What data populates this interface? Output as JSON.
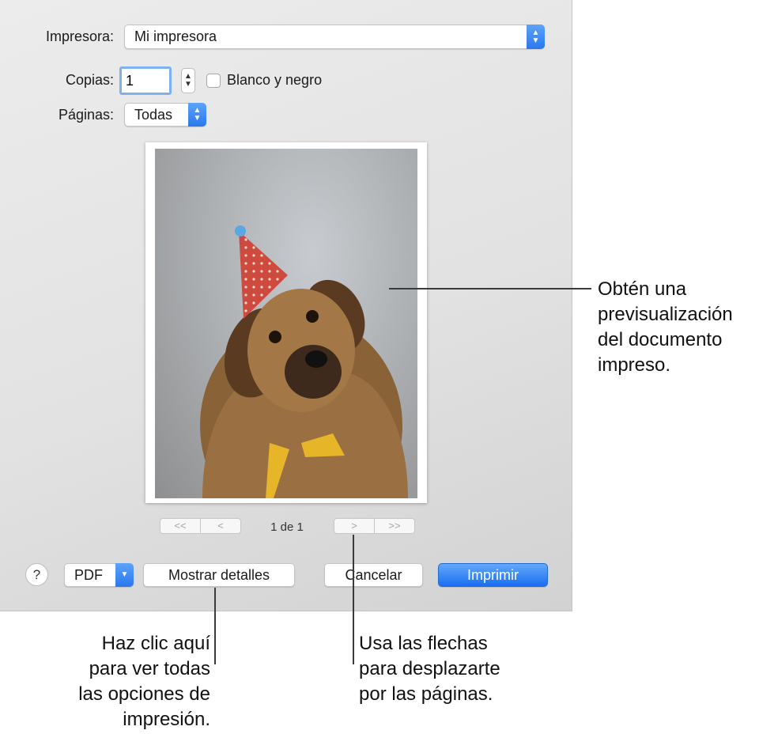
{
  "dialog": {
    "printer": {
      "label": "Impresora:",
      "value": "Mi impresora"
    },
    "copies": {
      "label": "Copias:",
      "value": "1"
    },
    "bw": {
      "label": "Blanco y negro",
      "checked": false
    },
    "pages": {
      "label": "Páginas:",
      "value": "Todas"
    },
    "preview": {
      "nav": {
        "first": "<<",
        "prev": "<",
        "next": ">",
        "last": ">>"
      },
      "page_indicator": "1 de 1"
    },
    "footer": {
      "help": "?",
      "pdf": "PDF",
      "details": "Mostrar detalles",
      "cancel": "Cancelar",
      "print": "Imprimir"
    }
  },
  "callouts": {
    "preview": [
      "Obtén una",
      "previsualización",
      "del documento",
      "impreso."
    ],
    "details": [
      "Haz clic aquí",
      "para ver todas",
      "las opciones de",
      "impresión."
    ],
    "arrows": [
      "Usa las flechas",
      "para desplazarte",
      "por las páginas."
    ]
  },
  "colors": {
    "accent": "#2a78ee",
    "connector": "#3a3a3a"
  }
}
